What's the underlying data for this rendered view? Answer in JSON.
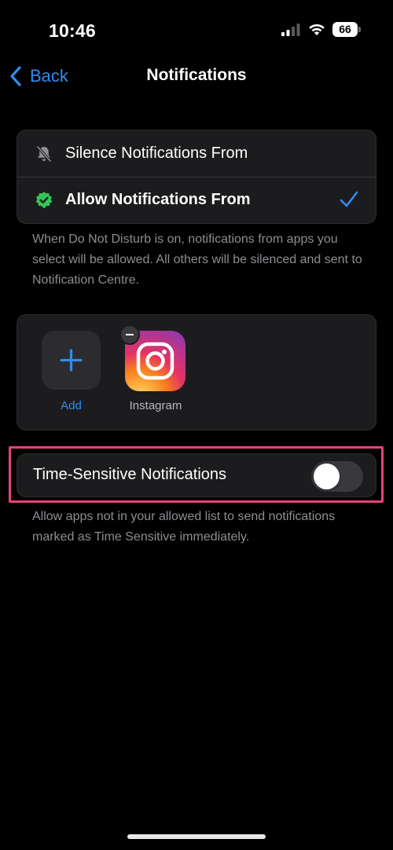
{
  "status_bar": {
    "time": "10:46",
    "battery": "66"
  },
  "nav": {
    "back_label": "Back",
    "title": "Notifications"
  },
  "mode_group": {
    "items": [
      {
        "label": "Silence Notifications From",
        "icon": "bell-slash-icon",
        "selected": false
      },
      {
        "label": "Allow Notifications From",
        "icon": "checkmark-seal-icon",
        "selected": true
      }
    ]
  },
  "mode_footnote": "When Do Not Disturb is on, notifications from apps you select will be allowed. All others will be silenced and sent to Notification Centre.",
  "apps": {
    "add_label": "Add",
    "items": [
      {
        "label": "Instagram",
        "icon": "instagram-icon"
      }
    ]
  },
  "time_sensitive": {
    "label": "Time-Sensitive Notifications",
    "enabled": false,
    "footnote": "Allow apps not in your allowed list to send notifications marked as Time Sensitive immediately."
  },
  "colors": {
    "accent": "#2f8cf2",
    "highlight": "#e8417b",
    "seal_green": "#30c759",
    "background": "#000000",
    "group_background": "#1c1c1e"
  }
}
